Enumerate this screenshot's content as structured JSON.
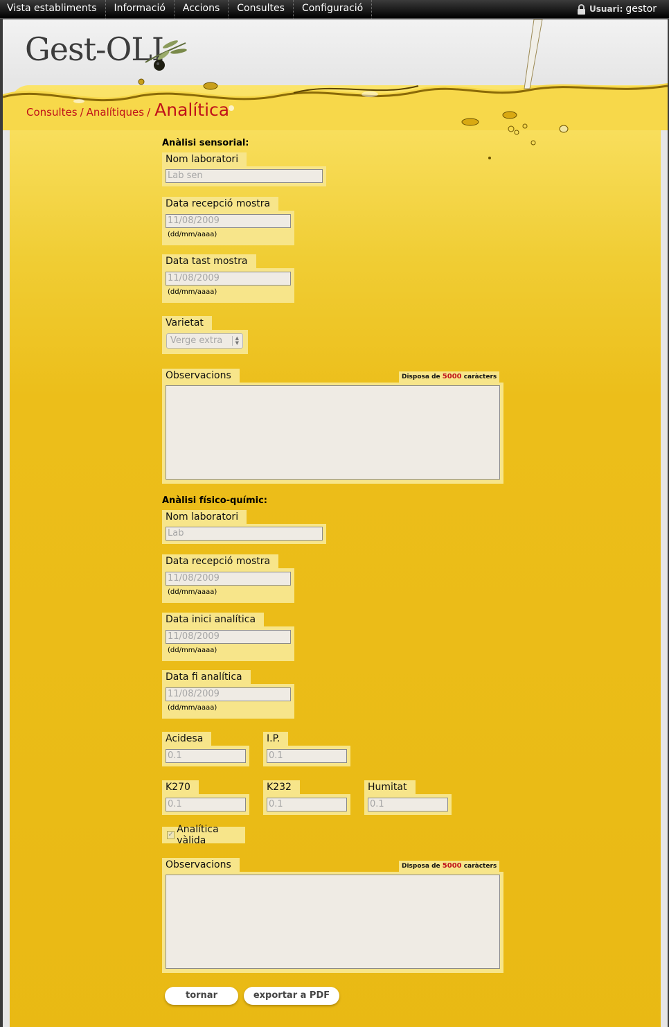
{
  "nav": {
    "items": [
      "Vista establiments",
      "Informació",
      "Accions",
      "Consultes",
      "Configuració"
    ],
    "user_label": "Usuari:",
    "user_name": "gestor"
  },
  "logo": "Gest-OLI",
  "breadcrumb": {
    "items": [
      "Consultes",
      "Analítiques"
    ],
    "separator": "/",
    "current": "Analítica"
  },
  "sensorial": {
    "title": "Anàlisi sensorial:",
    "lab_label": "Nom laboratori",
    "lab_value": "Lab sen",
    "reception_label": "Data recepció mostra",
    "reception_value": "11/08/2009",
    "reception_hint": "(dd/mm/aaaa)",
    "tasting_label": "Data tast mostra",
    "tasting_value": "11/08/2009",
    "tasting_hint": "(dd/mm/aaaa)",
    "variety_label": "Varietat",
    "variety_value": "Verge extra",
    "obs_label": "Observacions",
    "obs_value": "",
    "counter_pre": "Disposa de",
    "counter_num": "5000",
    "counter_post": "caràcters"
  },
  "fisico": {
    "title": "Anàlisi físico-químic:",
    "lab_label": "Nom laboratori",
    "lab_value": "Lab",
    "reception_label": "Data recepció mostra",
    "reception_value": "11/08/2009",
    "reception_hint": "(dd/mm/aaaa)",
    "start_label": "Data inici analítica",
    "start_value": "11/08/2009",
    "start_hint": "(dd/mm/aaaa)",
    "end_label": "Data fi analítica",
    "end_value": "11/08/2009",
    "end_hint": "(dd/mm/aaaa)",
    "acidesa_label": "Acidesa",
    "acidesa_value": "0.1",
    "ip_label": "I.P.",
    "ip_value": "0.1",
    "k270_label": "K270",
    "k270_value": "0.1",
    "k232_label": "K232",
    "k232_value": "0.1",
    "humitat_label": "Humitat",
    "humitat_value": "0.1",
    "valid_label": "Analítica vàlida",
    "valid_checked": true,
    "obs_label": "Observacions",
    "obs_value": "",
    "counter_pre": "Disposa de",
    "counter_num": "5000",
    "counter_post": "caràcters"
  },
  "buttons": {
    "back": "tornar",
    "export": "exportar a PDF"
  },
  "colors": {
    "accent": "#c0121a",
    "oil": "#ecbe1a",
    "field_bg": "#f7e58a"
  }
}
